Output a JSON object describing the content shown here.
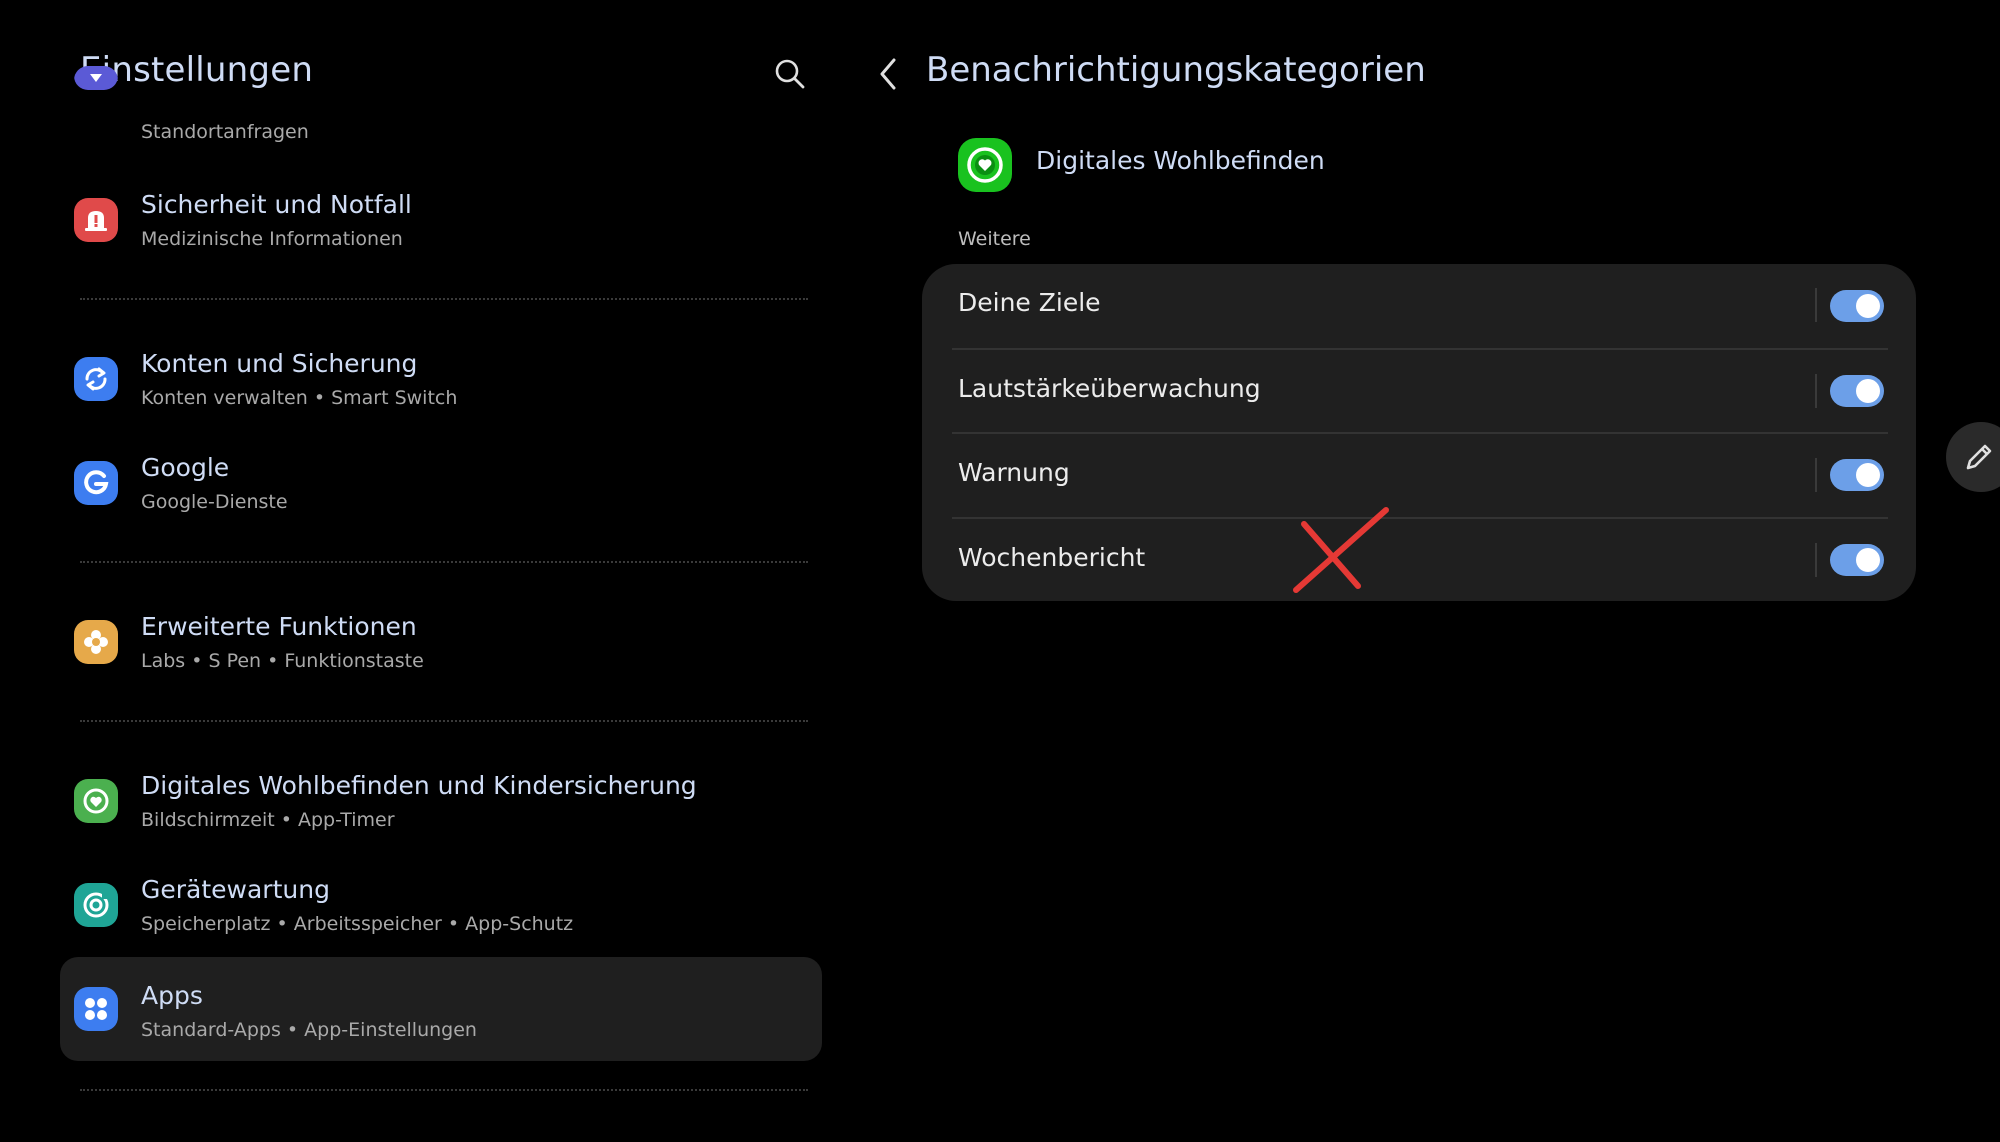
{
  "left": {
    "title": "Einstellungen",
    "items": [
      {
        "title": "",
        "subtitle": "Standortanfragen",
        "icon": "location-icon",
        "color": "#5b5ad6"
      },
      {
        "title": "Sicherheit und Notfall",
        "subtitle": "Medizinische Informationen",
        "icon": "emergency-icon",
        "color": "#e04a4a"
      },
      {
        "title": "Konten und Sicherung",
        "subtitle": "Konten verwalten  •  Smart Switch",
        "icon": "sync-icon",
        "color": "#3d7df0"
      },
      {
        "title": "Google",
        "subtitle": "Google-Dienste",
        "icon": "google-icon",
        "color": "#3d7df0"
      },
      {
        "title": "Erweiterte Funktionen",
        "subtitle": "Labs  •  S Pen  •  Funktionstaste",
        "icon": "puzzle-icon",
        "color": "#e6a94a"
      },
      {
        "title": "Digitales Wohlbefinden und Kindersicherung",
        "subtitle": "Bildschirmzeit  •  App-Timer",
        "icon": "wellbeing-icon",
        "color": "#4bb04f"
      },
      {
        "title": "Gerätewartung",
        "subtitle": "Speicherplatz  •  Arbeitsspeicher  •  App-Schutz",
        "icon": "device-care-icon",
        "color": "#1fa596"
      },
      {
        "title": "Apps",
        "subtitle": "Standard-Apps  •  App-Einstellungen",
        "icon": "apps-icon",
        "color": "#3d7df0",
        "selected": true
      }
    ]
  },
  "right": {
    "title": "Benachrichtigungskategorien",
    "app_name": "Digitales Wohlbefinden",
    "section_label": "Weitere",
    "categories": [
      {
        "label": "Deine Ziele",
        "enabled": true
      },
      {
        "label": "Lautstärkeüberwachung",
        "enabled": true
      },
      {
        "label": "Warnung",
        "enabled": true
      },
      {
        "label": "Wochenbericht",
        "enabled": true
      }
    ]
  },
  "colors": {
    "accent": "#6c9fe8",
    "title_text": "#cfdcf5",
    "card_bg": "#1f1f1f",
    "annotation": "#e53935"
  }
}
